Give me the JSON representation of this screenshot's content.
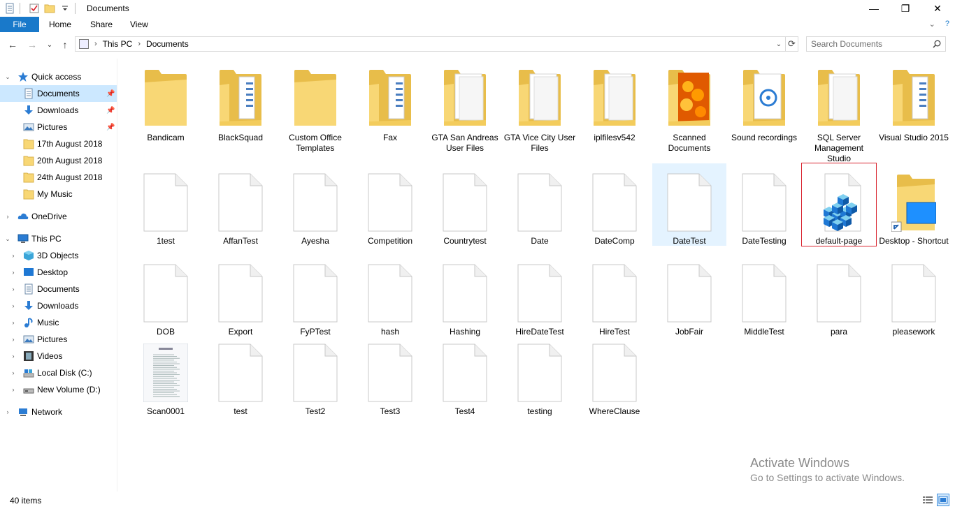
{
  "window": {
    "title": "Documents",
    "controls": {
      "minimize": "—",
      "maximize": "❐",
      "close": "✕"
    }
  },
  "ribbon": {
    "tabs": [
      "File",
      "Home",
      "Share",
      "View"
    ],
    "expand_glyph": "⌄",
    "help_glyph": "?"
  },
  "navigation": {
    "back": "←",
    "forward": "→",
    "recent": "⌄",
    "up": "↑",
    "refresh": "⟳",
    "breadcrumb": [
      "This PC",
      "Documents"
    ],
    "search_placeholder": "Search Documents"
  },
  "sidebar": {
    "quick_access": {
      "label": "Quick access",
      "items": [
        {
          "label": "Documents",
          "icon": "documents-icon",
          "pinned": true,
          "selected": true
        },
        {
          "label": "Downloads",
          "icon": "downloads-icon",
          "pinned": true
        },
        {
          "label": "Pictures",
          "icon": "pictures-icon",
          "pinned": true
        },
        {
          "label": "17th August 2018",
          "icon": "folder-icon"
        },
        {
          "label": "20th August 2018",
          "icon": "folder-icon"
        },
        {
          "label": "24th August 2018",
          "icon": "folder-icon"
        },
        {
          "label": "My Music",
          "icon": "folder-icon"
        }
      ]
    },
    "onedrive": "OneDrive",
    "this_pc": {
      "label": "This PC",
      "items": [
        {
          "label": "3D Objects",
          "icon": "3d-objects-icon"
        },
        {
          "label": "Desktop",
          "icon": "desktop-icon"
        },
        {
          "label": "Documents",
          "icon": "documents-icon"
        },
        {
          "label": "Downloads",
          "icon": "downloads-icon"
        },
        {
          "label": "Music",
          "icon": "music-icon"
        },
        {
          "label": "Pictures",
          "icon": "pictures-icon"
        },
        {
          "label": "Videos",
          "icon": "videos-icon"
        },
        {
          "label": "Local Disk (C:)",
          "icon": "local-disk-icon"
        },
        {
          "label": "New Volume (D:)",
          "icon": "drive-icon"
        }
      ]
    },
    "network": "Network"
  },
  "files": [
    {
      "name": "Bandicam",
      "type": "folder"
    },
    {
      "name": "BlackSquad",
      "type": "folder-docs"
    },
    {
      "name": "Custom Office Templates",
      "type": "folder"
    },
    {
      "name": "Fax",
      "type": "folder-docs"
    },
    {
      "name": "GTA San Andreas User Files",
      "type": "folder-pages"
    },
    {
      "name": "GTA Vice City User Files",
      "type": "folder-pages"
    },
    {
      "name": "iplfilesv542",
      "type": "folder-pages"
    },
    {
      "name": "Scanned Documents",
      "type": "folder-photo"
    },
    {
      "name": "Sound recordings",
      "type": "folder-sound"
    },
    {
      "name": "SQL Server Management Studio",
      "type": "folder-pages"
    },
    {
      "name": "Visual Studio 2015",
      "type": "folder-docs"
    },
    {
      "name": "1test",
      "type": "file"
    },
    {
      "name": "AffanTest",
      "type": "file"
    },
    {
      "name": "Ayesha",
      "type": "file"
    },
    {
      "name": "Competition",
      "type": "file"
    },
    {
      "name": "Countrytest",
      "type": "file"
    },
    {
      "name": "Date",
      "type": "file"
    },
    {
      "name": "DateComp",
      "type": "file"
    },
    {
      "name": "DateTest",
      "type": "file",
      "selected": true
    },
    {
      "name": "DateTesting",
      "type": "file"
    },
    {
      "name": "default-page",
      "type": "registry",
      "boxed": true
    },
    {
      "name": "Desktop - Shortcut",
      "type": "shortcut"
    },
    {
      "name": "DOB",
      "type": "file"
    },
    {
      "name": "Export",
      "type": "file"
    },
    {
      "name": "FyPTest",
      "type": "file"
    },
    {
      "name": "hash",
      "type": "file"
    },
    {
      "name": "Hashing",
      "type": "file"
    },
    {
      "name": "HireDateTest",
      "type": "file"
    },
    {
      "name": "HireTest",
      "type": "file"
    },
    {
      "name": "JobFair",
      "type": "file"
    },
    {
      "name": "MiddleTest",
      "type": "file"
    },
    {
      "name": "para",
      "type": "file"
    },
    {
      "name": "pleasework",
      "type": "file"
    },
    {
      "name": "Scan0001",
      "type": "scan"
    },
    {
      "name": "test",
      "type": "file"
    },
    {
      "name": "Test2",
      "type": "file"
    },
    {
      "name": "Test3",
      "type": "file"
    },
    {
      "name": "Test4",
      "type": "file"
    },
    {
      "name": "testing",
      "type": "file"
    },
    {
      "name": "WhereClause",
      "type": "file"
    }
  ],
  "status": {
    "item_count": "40 items"
  },
  "watermark": {
    "title": "Activate Windows",
    "subtitle": "Go to Settings to activate Windows."
  },
  "colors": {
    "accent": "#1979ca",
    "selection": "#cce8ff",
    "folder": "#f8d775",
    "highlight_box": "#d9232e"
  }
}
